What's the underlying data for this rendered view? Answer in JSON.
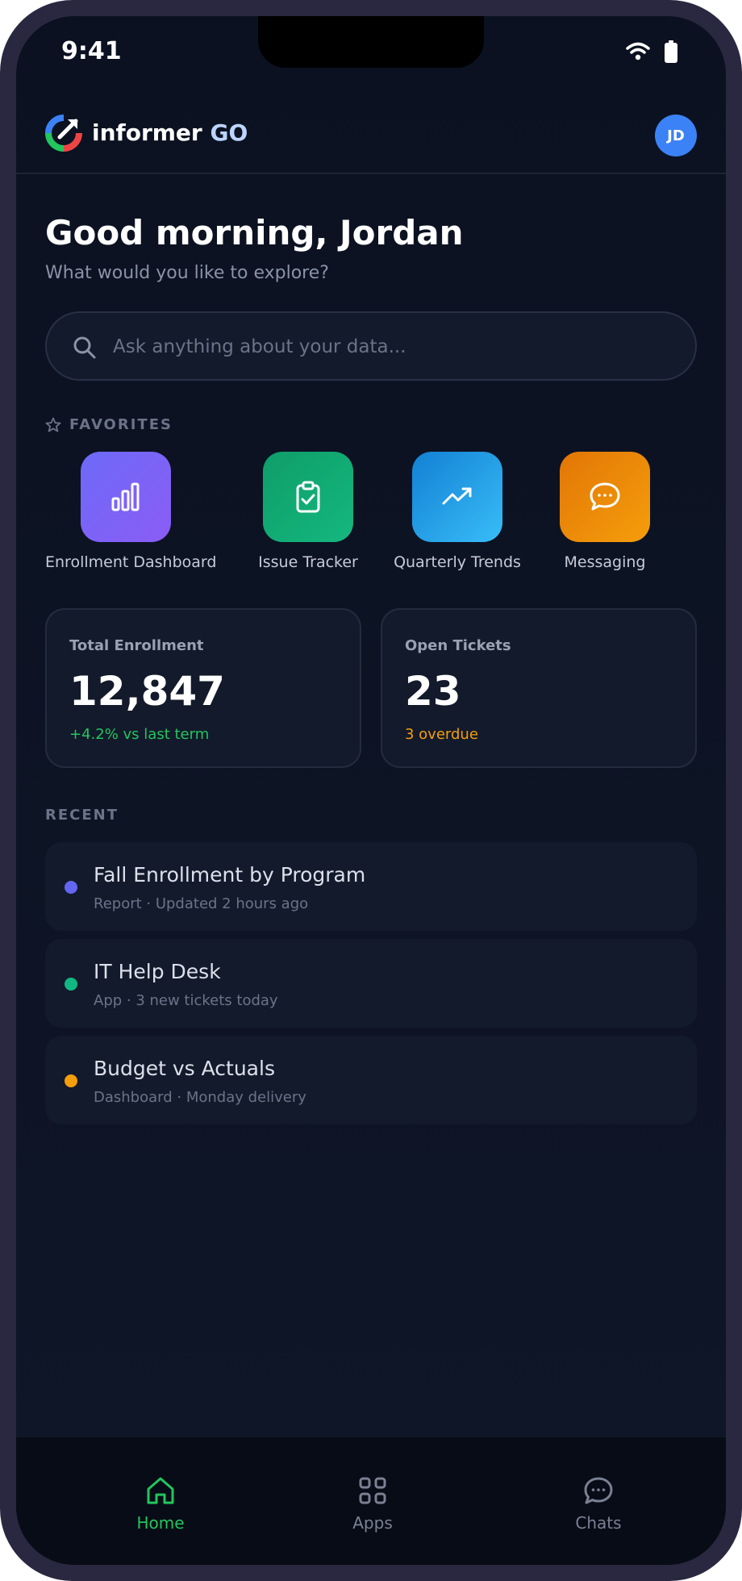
{
  "status_bar": {
    "time": "9:41"
  },
  "header": {
    "brand_name": "informer",
    "brand_suffix": "GO",
    "avatar_initials": "JD"
  },
  "greeting": {
    "title": "Good morning, Jordan",
    "subtitle": "What would you like to explore?"
  },
  "search": {
    "placeholder": "Ask anything about your data..."
  },
  "favorites": {
    "label": "FAVORITES",
    "items": [
      {
        "label": "Enrollment Dashboard",
        "icon": "bar-chart-icon",
        "color": "#7c5cf5"
      },
      {
        "label": "Issue Tracker",
        "icon": "clipboard-check-icon",
        "color": "#10a874"
      },
      {
        "label": "Quarterly Trends",
        "icon": "trending-up-icon",
        "color": "#1e9be6"
      },
      {
        "label": "Messaging",
        "icon": "chat-bubble-icon",
        "color": "#ef8d0c"
      }
    ]
  },
  "stats": [
    {
      "title": "Total Enrollment",
      "value": "12,847",
      "note": "+4.2% vs last term",
      "note_color": "#22c55e"
    },
    {
      "title": "Open Tickets",
      "value": "23",
      "note": "3 overdue",
      "note_color": "#f59e0b"
    }
  ],
  "recent": {
    "label": "RECENT",
    "items": [
      {
        "title": "Fall Enrollment by Program",
        "subtitle": "Report · Updated 2 hours ago",
        "dot_color": "#6366f1"
      },
      {
        "title": "IT Help Desk",
        "subtitle": "App · 3 new tickets today",
        "dot_color": "#10b981"
      },
      {
        "title": "Budget vs Actuals",
        "subtitle": "Dashboard · Monday delivery",
        "dot_color": "#f59e0b"
      }
    ]
  },
  "tabbar": {
    "active_color": "#22c55e",
    "inactive_color": "#7a8194",
    "items": [
      {
        "label": "Home",
        "icon": "home-icon",
        "active": true
      },
      {
        "label": "Apps",
        "icon": "grid-icon",
        "active": false
      },
      {
        "label": "Chats",
        "icon": "chat-icon",
        "active": false
      }
    ]
  }
}
